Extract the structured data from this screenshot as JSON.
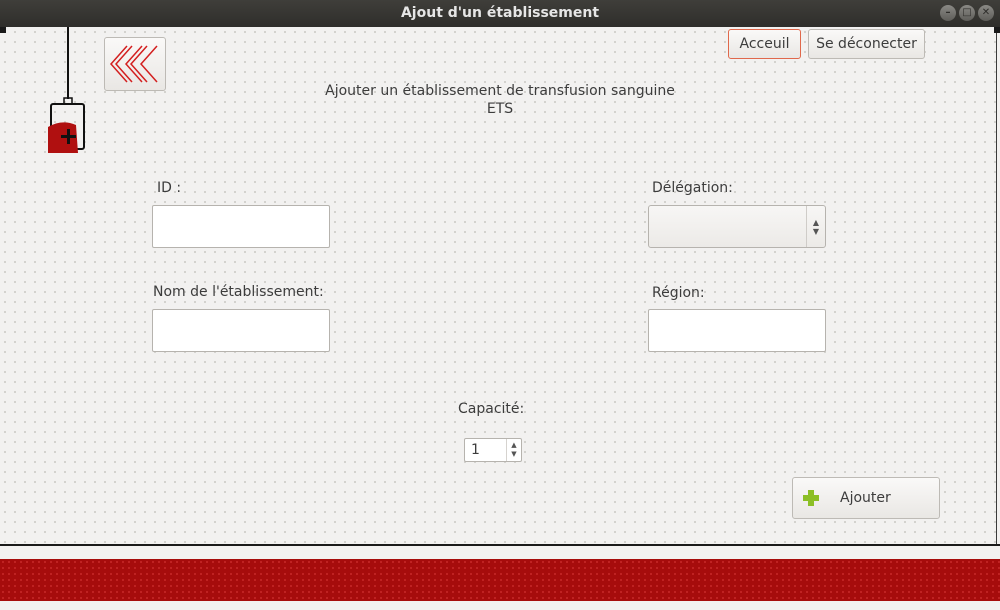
{
  "window": {
    "title": "Ajout d'un établissement",
    "controls": {
      "minimize": "–",
      "maximize": "□",
      "close": "✕"
    }
  },
  "toolbar": {
    "back_icon": "double-chevron-left-icon",
    "home_label": "Acceuil",
    "logout_label": "Se déconecter"
  },
  "logo": {
    "icon": "blood-bag-icon",
    "color": "#b01010"
  },
  "header": {
    "line1": "Ajouter un établissement de transfusion sanguine",
    "line2": "ETS"
  },
  "form": {
    "id_label": "ID :",
    "id_value": "",
    "name_label": "Nom de l'établissement:",
    "name_value": "",
    "delegation_label": "Délégation:",
    "delegation_value": "",
    "region_label": "Région:",
    "region_value": "",
    "capacity_label": "Capacité:",
    "capacity_value": "1",
    "submit_label": "Ajouter",
    "submit_icon": "plus-icon"
  },
  "colors": {
    "accent": "#a60c0c",
    "focus": "#e0684b",
    "plus": "#8cbf26"
  }
}
